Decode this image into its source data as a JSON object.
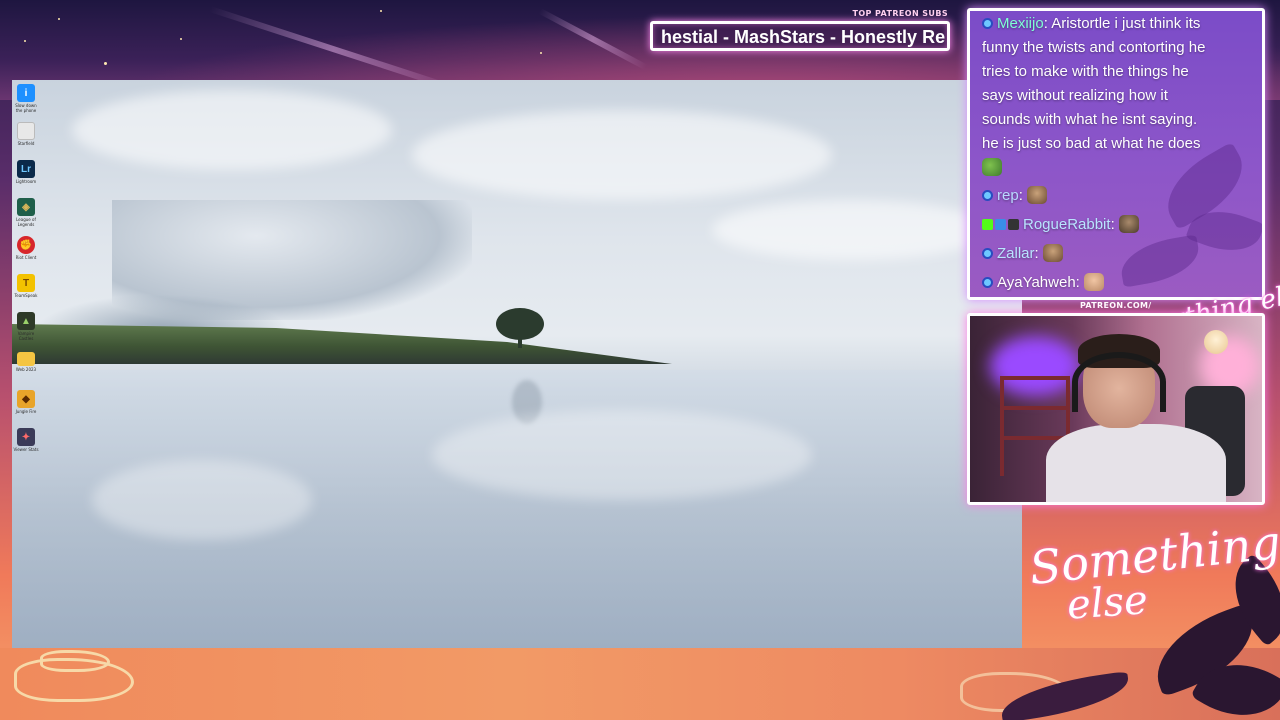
{
  "overlay": {
    "top_patreon_title": "TOP PATREON SUBS",
    "ticker_text": "hestial - MashStars - Honestly Re",
    "patreon_url": "PATREON.COM/",
    "brand_small": "Anything else?",
    "brand_large_line1": "Something",
    "brand_large_line2": "else"
  },
  "desktop": {
    "icons": [
      {
        "name": "Slow down the phone",
        "color": "#1e90ff",
        "glyph": "i"
      },
      {
        "name": "Starfield",
        "color": "#e8e8e8",
        "glyph": ""
      },
      {
        "name": "Lightroom",
        "color": "#0b2a4a",
        "glyph": "Lr"
      },
      {
        "name": "League of Legends",
        "color": "#1f5f4a",
        "glyph": "◈"
      },
      {
        "name": "Riot Client",
        "color": "#d7262b",
        "glyph": "✊"
      },
      {
        "name": "TeamSpeak",
        "color": "#f3c200",
        "glyph": "T"
      },
      {
        "name": "Vampire Castles",
        "color": "#2e3a28",
        "glyph": "▲"
      },
      {
        "name": "Web 2023",
        "color": "#f5c542",
        "glyph": ""
      },
      {
        "name": "Jungle Fire",
        "color": "#e8a42a",
        "glyph": "◆"
      },
      {
        "name": "Viewer Stats",
        "color": "#3a3a58",
        "glyph": "✦"
      }
    ]
  },
  "chat": {
    "messages": [
      {
        "user": "Mexiijo",
        "lines": [
          "Aristortle i just think its",
          "funny the twists and contorting he",
          "tries to make with the things he",
          "says without realizing how it",
          "sounds with what he isnt saying.",
          "he is just so bad at what he does"
        ],
        "emote": "pepe-emote"
      },
      {
        "user": "rep",
        "emote": "cat-emote"
      },
      {
        "user": "RogueRabbit",
        "emote": "fist-emote"
      },
      {
        "user": "Zallar",
        "emote": "cat-emote"
      },
      {
        "user": "AyaYahweh",
        "emote": "hand-emote"
      }
    ]
  },
  "colors": {
    "accent_glow": "#ff7be6",
    "chat_bg": "#7b4cc8",
    "username_mexiijo": "#7fffd4"
  }
}
